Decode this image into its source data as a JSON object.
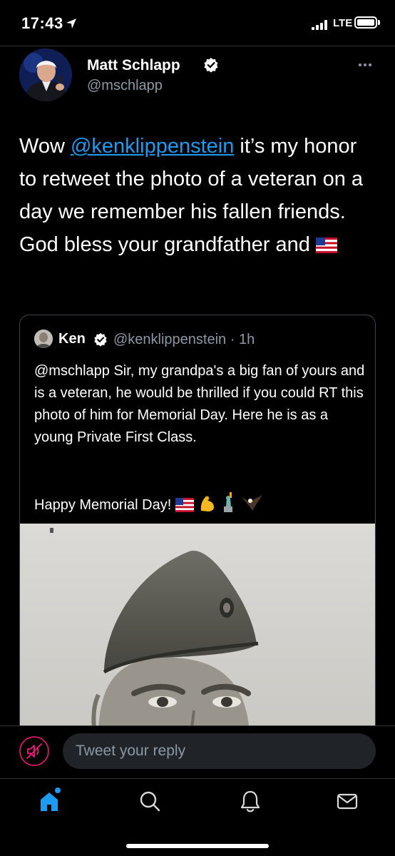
{
  "status_bar": {
    "time": "17:43",
    "network": "LTE"
  },
  "tweet": {
    "author_name": "Matt Schlapp",
    "author_handle": "@mschlapp",
    "text_prefix": "Wow ",
    "mention": "@kenklippenstein",
    "text_suffix": " it’s my honor to retweet the photo of a veteran on a day we remember his fallen friends. God bless your grandfather and "
  },
  "quote": {
    "author_name": "Ken",
    "handle_time": "@kenklippenstein · 1h",
    "text": "@mschlapp Sir, my grandpa's a big fan of yours and is a veteran, he would be thrilled if you could RT this photo of him for Memorial Day. Here he is as a young Private First Class.",
    "closing": "Happy Memorial Day!",
    "emojis": [
      "flag-us-emoji",
      "flexed-biceps-emoji",
      "statue-of-liberty-emoji",
      "eagle-emoji"
    ]
  },
  "reply": {
    "placeholder": "Tweet your reply"
  },
  "tab_bar": {
    "tabs": [
      "home-icon",
      "search-icon",
      "notifications-icon",
      "messages-icon"
    ],
    "active": "home"
  },
  "colors": {
    "background": "#000000",
    "accent": "#1d9bf0",
    "secondary_text": "#8b98a5",
    "border": "#2f3336",
    "reply_field": "#202327"
  }
}
